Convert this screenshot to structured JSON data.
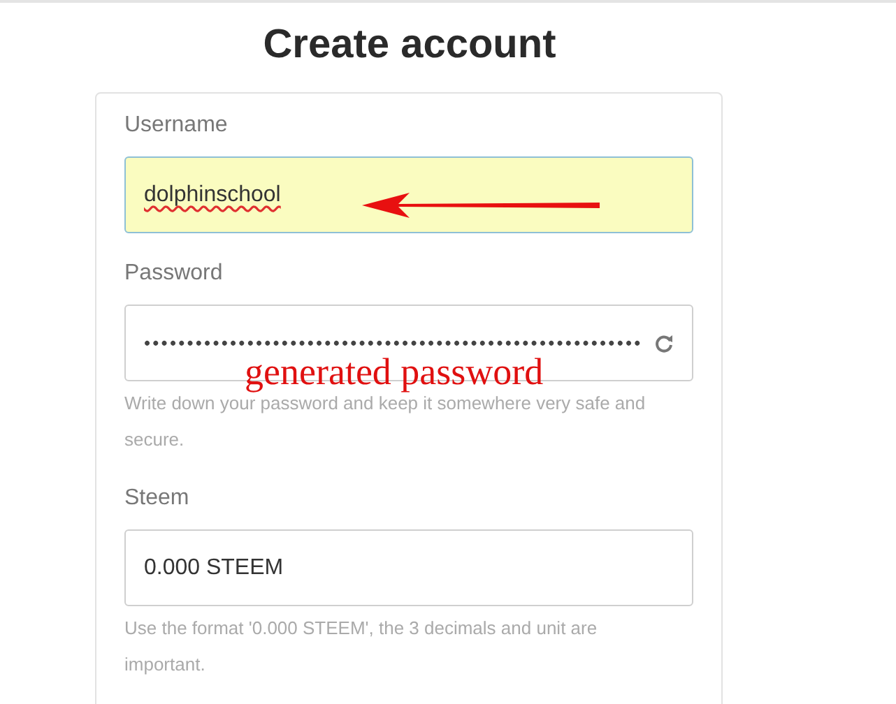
{
  "title": "Create account",
  "fields": [
    {
      "kind": "text",
      "label": "Username",
      "value": "dolphinschool",
      "autofilled": true,
      "misspelled": true
    },
    {
      "kind": "password",
      "label": "Password",
      "masked": "••••••••••••••••••••••••••••••••••••••••••••••••••••••••••",
      "hint": "Write down your password and keep it somewhere very safe and secure."
    },
    {
      "kind": "text",
      "label": "Steem",
      "value": "0.000 STEEM",
      "autofilled": false,
      "misspelled": false,
      "hint": "Use the format '0.000 STEEM', the 3 decimals and unit are important."
    }
  ],
  "annotation": {
    "text": "generated password"
  }
}
